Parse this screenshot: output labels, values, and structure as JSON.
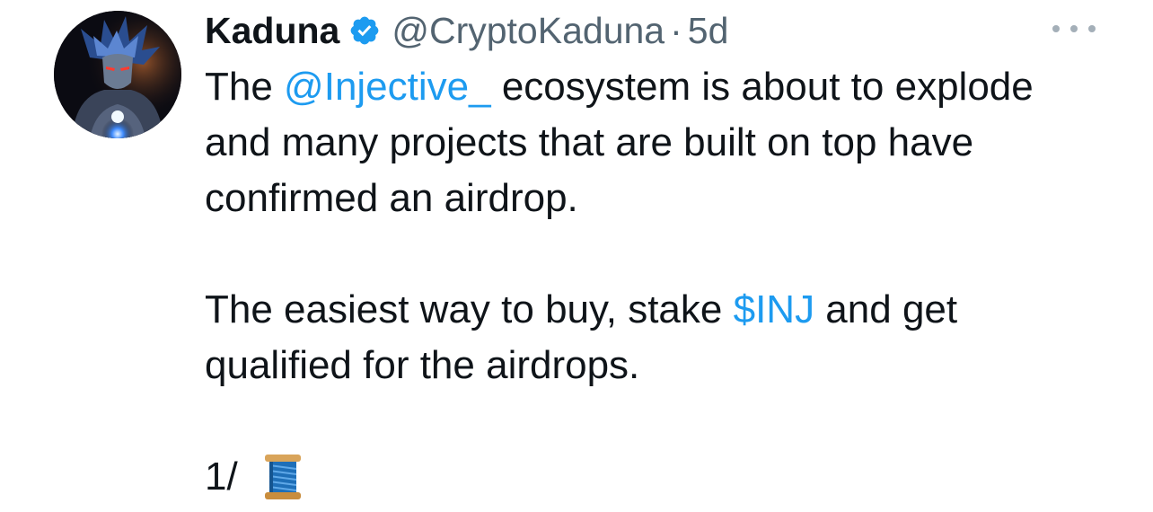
{
  "tweet": {
    "author": {
      "display_name": "Kaduna",
      "handle": "@CryptoKaduna",
      "verified": true,
      "avatar": "avatar-image"
    },
    "separator": "·",
    "timestamp": "5d",
    "more_icon": "more-horizontal-icon",
    "text": {
      "p1_before": "The ",
      "p1_mention": "@Injective_",
      "p1_after": " ecosystem is about to explode and many projects that are built on top have confirmed an airdrop.",
      "p2_before": "The easiest way to buy, stake ",
      "p2_cashtag": "$INJ",
      "p2_after": " and get qualified for the airdrops.",
      "p3_thread": "1/",
      "p3_emoji": "spool-of-thread-icon"
    },
    "colors": {
      "link": "#1d9bf0",
      "secondary": "#536471",
      "primary": "#0f1419",
      "verified_badge": "#1d9bf0"
    }
  }
}
